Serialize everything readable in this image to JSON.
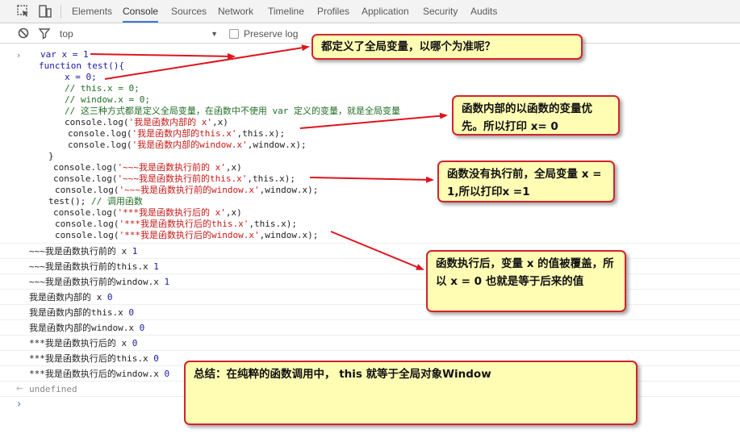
{
  "tabs": [
    "Elements",
    "Console",
    "Sources",
    "Network",
    "Timeline",
    "Profiles",
    "Application",
    "Security",
    "Audits"
  ],
  "active_tab": "Console",
  "filter": {
    "context": "top",
    "preserve_log_label": "Preserve log",
    "preserve_log_checked": false
  },
  "code": {
    "l1": "var x = 1",
    "l2": "function test(){",
    "l3": "x = 0;",
    "l4": "// this.x = 0;",
    "l5": "// window.x = 0;",
    "l6": "// 这三种方式都是定义全局变量，在函数中不使用 var 定义的变量，就是全局变量",
    "l7a": "console.log(",
    "l7b": "'我是函数内部的 x'",
    "l7c": ",x)",
    "l8a": "console.log(",
    "l8b": "'我是函数内部的this.x'",
    "l8c": ",this.x);",
    "l9a": "console.log(",
    "l9b": "'我是函数内部的window.x'",
    "l9c": ",window.x);",
    "l10": "}",
    "l11a": "console.log(",
    "l11b": "'~~~我是函数执行前的 x'",
    "l11c": ",x)",
    "l12a": "console.log(",
    "l12b": "'~~~我是函数执行前的this.x'",
    "l12c": ",this.x);",
    "l13a": "console.log(",
    "l13b": "'~~~我是函数执行前的window.x'",
    "l13c": ",window.x);",
    "l14a": "test();",
    "l14b": "// 调用函数",
    "l15a": "console.log(",
    "l15b": "'***我是函数执行后的 x'",
    "l15c": ",x)",
    "l16a": "console.log(",
    "l16b": "'***我是函数执行后的this.x'",
    "l16c": ",this.x);",
    "l17a": "console.log(",
    "l17b": "'***我是函数执行后的window.x'",
    "l17c": ",window.x);"
  },
  "output": [
    {
      "text": "~~~我是函数执行前的 x",
      "value": "1"
    },
    {
      "text": "~~~我是函数执行前的this.x",
      "value": "1"
    },
    {
      "text": "~~~我是函数执行前的window.x",
      "value": "1"
    },
    {
      "text": "我是函数内部的 x",
      "value": "0"
    },
    {
      "text": "我是函数内部的this.x",
      "value": "0"
    },
    {
      "text": "我是函数内部的window.x",
      "value": "0"
    },
    {
      "text": "***我是函数执行后的 x",
      "value": "0"
    },
    {
      "text": "***我是函数执行后的this.x",
      "value": "0"
    },
    {
      "text": "***我是函数执行后的window.x",
      "value": "0"
    }
  ],
  "result": "undefined",
  "notes": {
    "n1": "都定义了全局变量，以哪个为准呢？",
    "n2": "函数内部的以函数的变量优先。所以打印 x= 0",
    "n3": "函数没有执行前，全局变量 x = 1,所以打印x =1",
    "n4": "函数执行后，变量 x 的值被覆盖，所以 x = 0 也就是等于后来的值",
    "n5": "总结：在纯粹的函数调用中， this 就等于全局对象Window"
  },
  "colors": {
    "note_bg": "#fffcb4",
    "note_border": "#d2242d",
    "arrow": "#e0141e",
    "tab_accent": "#3879d9"
  },
  "icons": [
    "inspect-icon",
    "device-toggle-icon",
    "clear-console-icon",
    "filter-icon",
    "prompt-chevron-icon",
    "result-chevron-icon"
  ]
}
